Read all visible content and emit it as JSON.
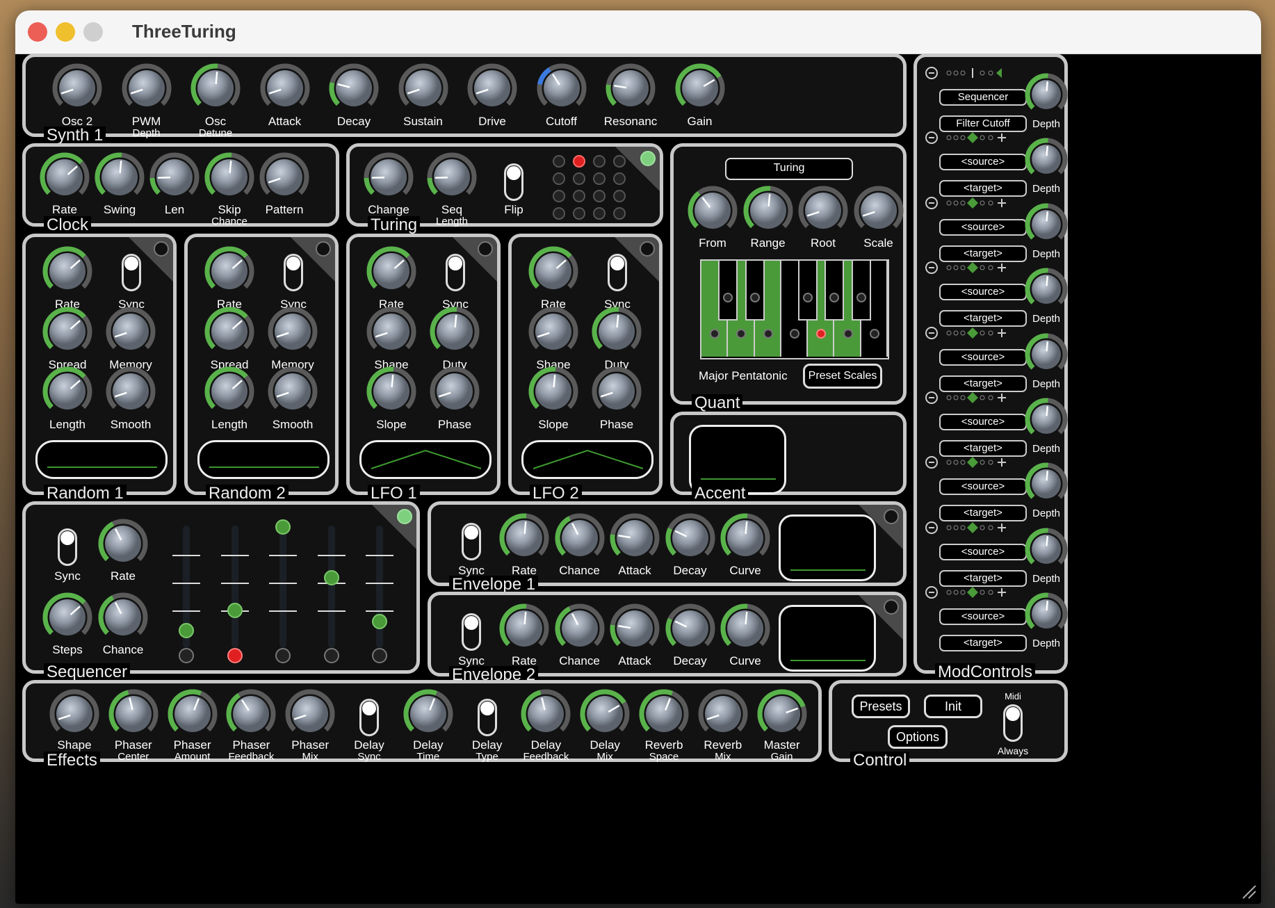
{
  "window": {
    "title": "ThreeTuring"
  },
  "colors": {
    "accent_green": "#59b34a",
    "knob_track": "#5a5a5a",
    "panel_border": "#c8c8c8",
    "blue_mod": "#3a7ae0",
    "red_led": "#e02020"
  },
  "synth": {
    "label": "Synth 1",
    "knobs": [
      {
        "label": "Osc 2",
        "value": 0.1
      },
      {
        "label": "PWM\nDepth",
        "value": 0.1
      },
      {
        "label": "Osc\nDetune",
        "value": 0.52
      },
      {
        "label": "Attack",
        "value": 0.1
      },
      {
        "label": "Decay",
        "value": 0.22
      },
      {
        "label": "Sustain",
        "value": 0.1
      },
      {
        "label": "Drive",
        "value": 0.1
      },
      {
        "label": "Cutoff",
        "value": 0.38,
        "mod": true
      },
      {
        "label": "Resonanc",
        "value": 0.2
      },
      {
        "label": "Gain",
        "value": 0.72
      }
    ]
  },
  "clock": {
    "label": "Clock",
    "knobs": [
      {
        "label": "Rate",
        "value": 0.68
      },
      {
        "label": "Swing",
        "value": 0.52
      },
      {
        "label": "Len",
        "value": 0.16
      },
      {
        "label": "Skip\nChance",
        "value": 0.52
      },
      {
        "label": "Pattern",
        "value": 0.1
      }
    ]
  },
  "turing": {
    "label": "Turing",
    "knobs": [
      {
        "label": "Change",
        "value": 0.16
      },
      {
        "label": "Seq\nLength",
        "value": 0.16
      }
    ],
    "toggle": {
      "label": "Flip",
      "on": true
    }
  },
  "quant": {
    "label": "Quant",
    "mode": "Turing",
    "knobs": [
      {
        "label": "From",
        "value": 0.36
      },
      {
        "label": "Range",
        "value": 0.52
      },
      {
        "label": "Root",
        "value": 0.1
      },
      {
        "label": "Scale",
        "value": 0.1
      }
    ],
    "scale_name": "Major Pentatonic",
    "preset_button": "Preset Scales"
  },
  "random1": {
    "label": "Random 1",
    "knobs": [
      {
        "label": "Rate",
        "value": 0.68,
        "t": "Rate"
      },
      {
        "label": "Spread",
        "value": 0.68
      },
      {
        "label": "Memory",
        "value": 0.1
      },
      {
        "label": "Length",
        "value": 0.68
      },
      {
        "label": "Smooth",
        "value": 0.1
      }
    ],
    "toggle": {
      "label": "Sync"
    }
  },
  "random2": {
    "label": "Random 2",
    "knobs": [
      {
        "label": "Rate",
        "value": 0.68
      },
      {
        "label": "Spread",
        "value": 0.68
      },
      {
        "label": "Memory",
        "value": 0.1
      },
      {
        "label": "Length",
        "value": 0.68
      },
      {
        "label": "Smooth",
        "value": 0.1
      }
    ],
    "toggle": {
      "label": "Sync"
    }
  },
  "lfo1": {
    "label": "LFO 1",
    "knobs": [
      {
        "label": "Rate",
        "value": 0.68
      },
      {
        "label": "Shape",
        "value": 0.1
      },
      {
        "label": "Duty",
        "value": 0.52
      },
      {
        "label": "Slope",
        "value": 0.52
      },
      {
        "label": "Phase",
        "value": 0.1
      }
    ],
    "toggle": {
      "label": "Sync"
    }
  },
  "lfo2": {
    "label": "LFO 2",
    "knobs": [
      {
        "label": "Rate",
        "value": 0.68
      },
      {
        "label": "Shape",
        "value": 0.1
      },
      {
        "label": "Duty",
        "value": 0.52
      },
      {
        "label": "Slope",
        "value": 0.52
      },
      {
        "label": "Phase",
        "value": 0.1
      }
    ],
    "toggle": {
      "label": "Sync"
    }
  },
  "accent": {
    "label": "Accent"
  },
  "sequencer": {
    "label": "Sequencer",
    "toggle": {
      "label": "Sync"
    },
    "knobs": [
      {
        "label": "Rate",
        "value": 0.4
      },
      {
        "label": "Steps",
        "value": 0.68
      },
      {
        "label": "Chance",
        "value": 0.4
      }
    ],
    "steps": [
      0.1,
      0.28,
      1.0,
      0.56,
      0.18
    ]
  },
  "env1": {
    "label": "Envelope 1",
    "toggle": {
      "label": "Sync"
    },
    "knobs": [
      {
        "label": "Rate",
        "value": 0.52
      },
      {
        "label": "Chance",
        "value": 0.4
      },
      {
        "label": "Attack",
        "value": 0.2
      },
      {
        "label": "Decay",
        "value": 0.26
      },
      {
        "label": "Curve",
        "value": 0.52
      }
    ]
  },
  "env2": {
    "label": "Envelope 2",
    "toggle": {
      "label": "Sync"
    },
    "knobs": [
      {
        "label": "Rate",
        "value": 0.52
      },
      {
        "label": "Chance",
        "value": 0.4
      },
      {
        "label": "Attack",
        "value": 0.2
      },
      {
        "label": "Decay",
        "value": 0.26
      },
      {
        "label": "Curve",
        "value": 0.52
      }
    ]
  },
  "mod": {
    "label": "ModControls",
    "slots": [
      {
        "source": "Sequencer",
        "target": "Filter Cutoff",
        "depth_label": "Depth"
      },
      {
        "source": "<source>",
        "target": "<target>",
        "depth_label": "Depth"
      },
      {
        "source": "<source>",
        "target": "<target>",
        "depth_label": "Depth"
      },
      {
        "source": "<source>",
        "target": "<target>",
        "depth_label": "Depth"
      },
      {
        "source": "<source>",
        "target": "<target>",
        "depth_label": "Depth"
      },
      {
        "source": "<source>",
        "target": "<target>",
        "depth_label": "Depth"
      },
      {
        "source": "<source>",
        "target": "<target>",
        "depth_label": "Depth"
      },
      {
        "source": "<source>",
        "target": "<target>",
        "depth_label": "Depth"
      },
      {
        "source": "<source>",
        "target": "<target>",
        "depth_label": "Depth"
      }
    ]
  },
  "effects": {
    "label": "Effects",
    "items": [
      {
        "type": "knob",
        "label": "Shape",
        "value": 0.1
      },
      {
        "type": "knob",
        "label": "Phaser\nCenter",
        "value": 0.45
      },
      {
        "type": "knob",
        "label": "Phaser\nAmount",
        "value": 0.58
      },
      {
        "type": "knob",
        "label": "Phaser\nFeedback",
        "value": 0.38
      },
      {
        "type": "knob",
        "label": "Phaser\nMix",
        "value": 0.1
      },
      {
        "type": "toggle",
        "label": "Delay\nSync"
      },
      {
        "type": "knob",
        "label": "Delay\nTime",
        "value": 0.58
      },
      {
        "type": "toggle",
        "label": "Delay\nType"
      },
      {
        "type": "knob",
        "label": "Delay\nFeedback",
        "value": 0.45
      },
      {
        "type": "knob",
        "label": "Delay\nMix",
        "value": 0.72
      },
      {
        "type": "knob",
        "label": "Reverb\nSpace",
        "value": 0.58
      },
      {
        "type": "knob",
        "label": "Reverb\nMix",
        "value": 0.1
      },
      {
        "type": "knob",
        "label": "Master\nGain",
        "value": 0.76
      }
    ]
  },
  "control": {
    "label": "Control",
    "presets": "Presets",
    "init": "Init",
    "options": "Options",
    "midi_top": "Midi",
    "midi_bottom": "Always"
  }
}
